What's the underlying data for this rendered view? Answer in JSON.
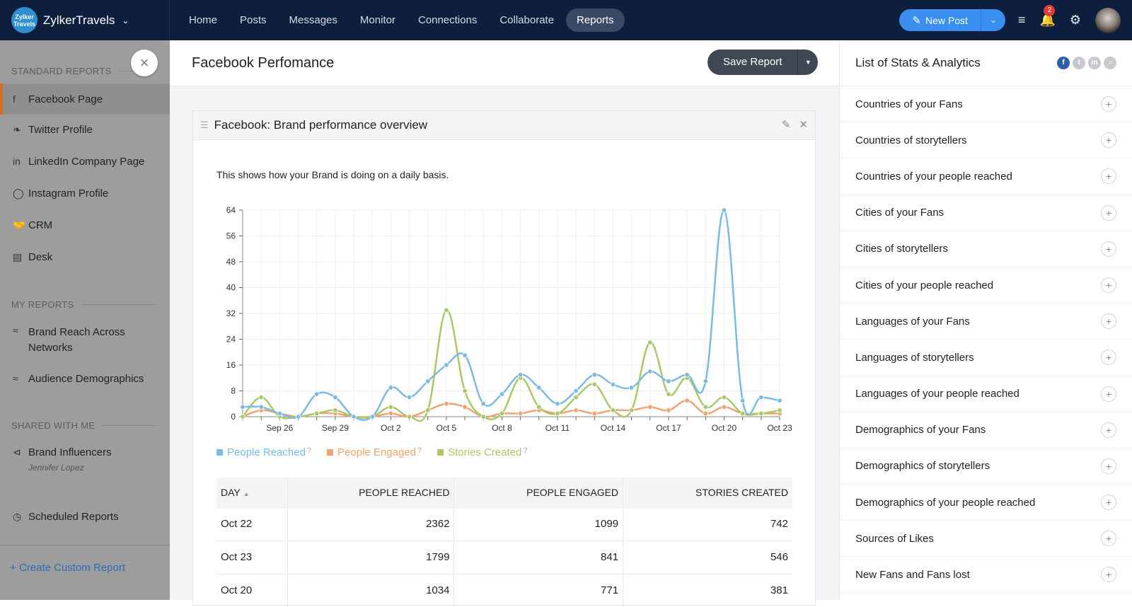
{
  "topbar": {
    "brand_logo": "Zylker Travels",
    "brand_name": "ZylkerTravels",
    "nav": [
      "Home",
      "Posts",
      "Messages",
      "Monitor",
      "Connections",
      "Collaborate",
      "Reports"
    ],
    "active_nav": "Reports",
    "new_post_label": "New Post",
    "notification_count": "2"
  },
  "sidebar": {
    "sections": {
      "standard": "STANDARD REPORTS",
      "my": "MY REPORTS",
      "shared": "SHARED WITH ME"
    },
    "standard_items": [
      {
        "label": "Facebook Page",
        "icon": "facebook-icon"
      },
      {
        "label": "Twitter Profile",
        "icon": "twitter-icon"
      },
      {
        "label": "LinkedIn Company Page",
        "icon": "linkedin-icon"
      },
      {
        "label": "Instagram Profile",
        "icon": "instagram-icon"
      },
      {
        "label": "CRM",
        "icon": "handshake-icon"
      },
      {
        "label": "Desk",
        "icon": "desk-icon"
      }
    ],
    "my_items": [
      {
        "label": "Brand Reach Across Networks",
        "icon": "trend-icon"
      },
      {
        "label": "Audience Demographics",
        "icon": "trend-icon"
      }
    ],
    "shared_items": [
      {
        "label": "Brand Influencers",
        "sub": "Jennifer Lopez",
        "icon": "share-icon"
      }
    ],
    "scheduled": "Scheduled Reports",
    "create": "Create Custom Report"
  },
  "main": {
    "title": "Facebook Perfomance",
    "save_label": "Save Report",
    "card_title": "Facebook: Brand performance overview",
    "card_desc": "This shows how your Brand is doing on a daily basis."
  },
  "table": {
    "headers": [
      "DAY",
      "PEOPLE REACHED",
      "PEOPLE ENGAGED",
      "STORIES CREATED"
    ],
    "rows": [
      [
        "Oct 22",
        "2362",
        "1099",
        "742"
      ],
      [
        "Oct 23",
        "1799",
        "841",
        "546"
      ],
      [
        "Oct 20",
        "1034",
        "771",
        "381"
      ]
    ]
  },
  "right_panel": {
    "title": "List of Stats & Analytics",
    "items": [
      "Countries of your Fans",
      "Countries of storytellers",
      "Countries of your people reached",
      "Cities of your Fans",
      "Cities of storytellers",
      "Cities of your people reached",
      "Languages of your Fans",
      "Languages of storytellers",
      "Languages of your people reached",
      "Demographics of your Fans",
      "Demographics of storytellers",
      "Demographics of your people reached",
      "Sources of Likes",
      "New Fans and Fans lost"
    ]
  },
  "chart_data": {
    "type": "line",
    "title": "",
    "xlabel": "",
    "ylabel": "",
    "ylim": [
      0,
      64
    ],
    "yticks": [
      0,
      8,
      16,
      24,
      32,
      40,
      48,
      56,
      64
    ],
    "x": [
      "Sep 24",
      "Sep 25",
      "Sep 26",
      "Sep 27",
      "Sep 28",
      "Sep 29",
      "Sep 30",
      "Oct 1",
      "Oct 2",
      "Oct 3",
      "Oct 4",
      "Oct 5",
      "Oct 6",
      "Oct 7",
      "Oct 8",
      "Oct 9",
      "Oct 10",
      "Oct 11",
      "Oct 12",
      "Oct 13",
      "Oct 14",
      "Oct 15",
      "Oct 16",
      "Oct 17",
      "Oct 18",
      "Oct 19",
      "Oct 20",
      "Oct 21",
      "Oct 22",
      "Oct 23"
    ],
    "xtick_labels": [
      "Sep 26",
      "Sep 29",
      "Oct 2",
      "Oct 5",
      "Oct 8",
      "Oct 11",
      "Oct 14",
      "Oct 17",
      "Oct 20",
      "Oct 23"
    ],
    "grid": true,
    "legend": "bottom-left",
    "series": [
      {
        "name": "People Reached",
        "color": "#7cb9e3",
        "values": [
          3,
          3,
          1,
          0,
          7,
          6,
          0,
          0,
          9,
          6,
          11,
          16,
          19,
          4,
          7,
          13,
          9,
          4,
          8,
          13,
          10,
          9,
          14,
          11,
          13,
          11,
          64,
          5,
          6,
          5
        ]
      },
      {
        "name": "People Engaged",
        "color": "#f0a26f",
        "values": [
          0,
          2,
          1,
          0,
          1,
          1,
          0,
          0,
          1,
          0,
          2,
          4,
          3,
          0,
          1,
          1,
          2,
          1,
          2,
          1,
          2,
          2,
          3,
          2,
          5,
          1,
          3,
          1,
          1,
          1
        ]
      },
      {
        "name": "Stories Created",
        "color": "#a9c86a",
        "values": [
          0,
          6,
          0,
          0,
          1,
          2,
          0,
          0,
          3,
          0,
          2,
          33,
          8,
          0,
          1,
          12,
          3,
          1,
          6,
          10,
          2,
          2,
          23,
          7,
          12,
          3,
          6,
          1,
          1,
          2
        ]
      }
    ]
  }
}
